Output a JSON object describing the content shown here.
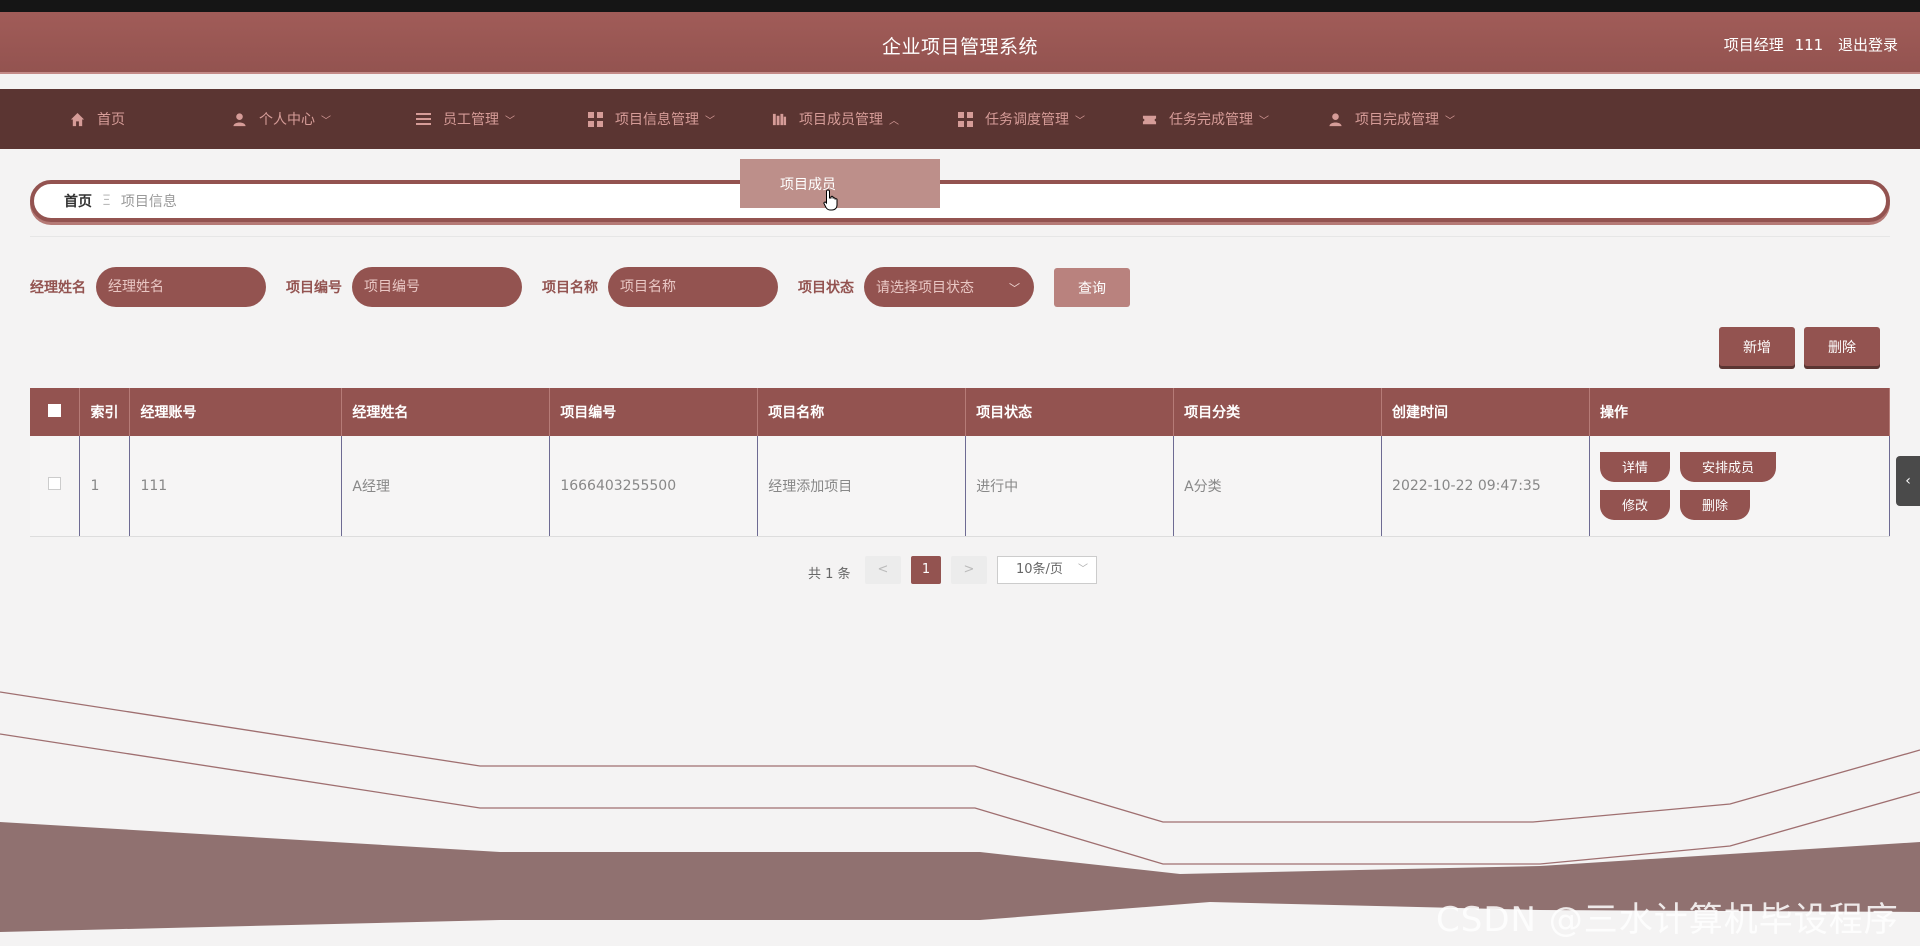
{
  "header": {
    "title": "企业项目管理系统",
    "role": "项目经理",
    "user_id": "111",
    "logout": "退出登录"
  },
  "nav": {
    "items": [
      {
        "label": "首页",
        "icon": "home-icon"
      },
      {
        "label": "个人中心",
        "icon": "user-icon"
      },
      {
        "label": "员工管理",
        "icon": "menu-icon"
      },
      {
        "label": "项目信息管理",
        "icon": "grid-icon"
      },
      {
        "label": "项目成员管理",
        "icon": "books-icon"
      },
      {
        "label": "任务调度管理",
        "icon": "grid-icon"
      },
      {
        "label": "任务完成管理",
        "icon": "ticket-icon"
      },
      {
        "label": "项目完成管理",
        "icon": "user-icon"
      }
    ],
    "dropdown_item": "项目成员"
  },
  "breadcrumb": {
    "home": "首页",
    "current": "项目信息"
  },
  "search": {
    "manager_name_label": "经理姓名",
    "manager_name_placeholder": "经理姓名",
    "project_no_label": "项目编号",
    "project_no_placeholder": "项目编号",
    "project_name_label": "项目名称",
    "project_name_placeholder": "项目名称",
    "status_label": "项目状态",
    "status_placeholder": "请选择项目状态",
    "query_button": "查询"
  },
  "actions": {
    "add": "新增",
    "delete": "删除"
  },
  "table": {
    "headers": [
      "索引",
      "经理账号",
      "经理姓名",
      "项目编号",
      "项目名称",
      "项目状态",
      "项目分类",
      "创建时间",
      "操作"
    ],
    "rows": [
      {
        "index": "1",
        "manager_account": "111",
        "manager_name": "A经理",
        "project_no": "1666403255500",
        "project_name": "经理添加项目",
        "status": "进行中",
        "category": "A分类",
        "created": "2022-10-22 09:47:35"
      }
    ],
    "ops": {
      "detail": "详情",
      "arrange": "安排成员",
      "edit": "修改",
      "delete": "删除"
    }
  },
  "pager": {
    "total": "共 1 条",
    "prev": "<",
    "page": "1",
    "next": ">",
    "page_size": "10条/页"
  },
  "watermark": "CSDN @三水计算机毕设程序",
  "colors": {
    "primary": "#935350",
    "nav_bg": "#5b3532",
    "accent_light": "#bd8f8a"
  }
}
